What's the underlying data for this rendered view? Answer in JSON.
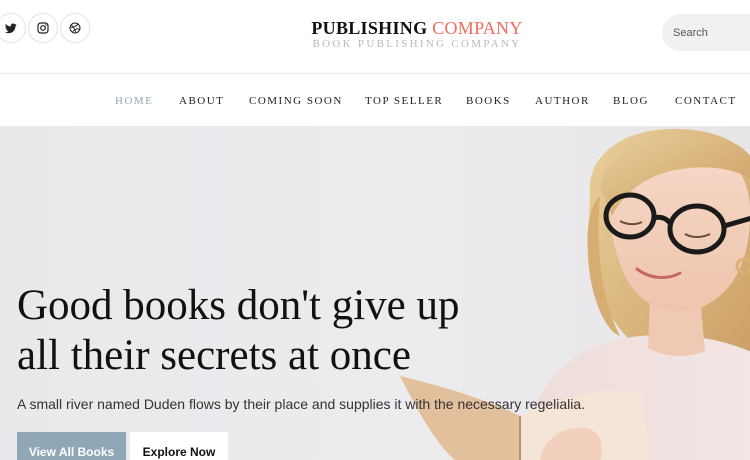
{
  "header": {
    "brand_main": "PUBLISHING",
    "brand_accent": "COMPANY",
    "brand_subtitle": "BOOK PUBLISHING COMPANY",
    "social_icons": [
      "twitter-icon",
      "instagram-icon",
      "dribbble-icon"
    ],
    "search": {
      "placeholder": "Search"
    }
  },
  "nav": {
    "items": [
      {
        "label": "HOME",
        "active": true
      },
      {
        "label": "ABOUT"
      },
      {
        "label": "COMING SOON"
      },
      {
        "label": "TOP SELLER"
      },
      {
        "label": "BOOKS"
      },
      {
        "label": "AUTHOR"
      },
      {
        "label": "BLOG"
      },
      {
        "label": "CONTACT"
      }
    ]
  },
  "hero": {
    "headline_line1": "Good books don't give up",
    "headline_line2": "all their secrets at once",
    "tagline": "A small river named Duden flows by their place and supplies it with the necessary regelialia.",
    "primary_button": "View All Books",
    "secondary_button": "Explore Now"
  },
  "colors": {
    "accent": "#f26b5b",
    "primary_button": "#8fa7b6",
    "active_nav": "#8fa7b6"
  }
}
